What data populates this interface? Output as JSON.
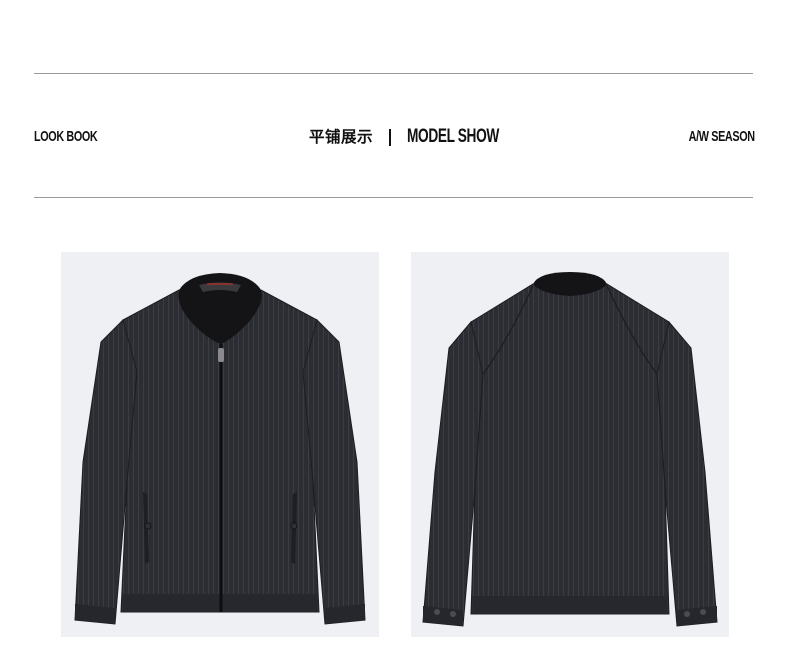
{
  "header": {
    "left_label": "LOOK BOOK",
    "center_cn": "平铺展示",
    "center_divider": "|",
    "center_en": "MODEL SHOW",
    "right_label": "A/W SEASON"
  },
  "gallery": {
    "items": [
      {
        "view": "front",
        "icon": "jacket-front-image"
      },
      {
        "view": "back",
        "icon": "jacket-back-image"
      }
    ]
  },
  "colors": {
    "background": "#ffffff",
    "rule": "#9a9a9a",
    "photo_bg": "#eef0f3",
    "jacket": "#2b2d33",
    "collar": "#141416"
  }
}
